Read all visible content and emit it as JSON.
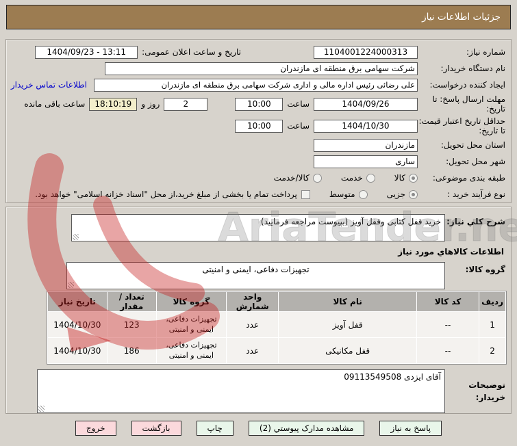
{
  "title": "جزئیات اطلاعات نیاز",
  "form": {
    "need_number": {
      "label": "شماره نیاز:",
      "value": "1104001224000313"
    },
    "announce": {
      "label": "تاریخ و ساعت اعلان عمومی:",
      "value": "1404/09/23 - 13:11"
    },
    "buyer_org": {
      "label": "نام دستگاه خریدار:",
      "value": "شرکت سهامی برق منطقه ای مازندران"
    },
    "creator": {
      "label": "ایجاد کننده درخواست:",
      "value": "علی رضائی رئیس اداره مالی و اداری شرکت سهامی برق منطقه ای مازندران",
      "contact_link": "اطلاعات تماس خریدار"
    },
    "deadline": {
      "label": "مهلت ارسال پاسخ: تا تاریخ:",
      "date": "1404/09/26",
      "time_label": "ساعت",
      "time": "10:00"
    },
    "countdown": {
      "days": "2",
      "days_suffix": "روز و",
      "time": "18:10:19",
      "time_suffix": "ساعت باقی مانده"
    },
    "validity": {
      "label": "حداقل تاریخ اعتبار قیمت: تا تاریخ:",
      "date": "1404/10/30",
      "time_label": "ساعت",
      "time": "10:00"
    },
    "province": {
      "label": "استان محل تحویل:",
      "value": "مازندران"
    },
    "city": {
      "label": "شهر محل تحویل:",
      "value": "ساری"
    },
    "classification": {
      "label": "طبقه بندی موضوعی:",
      "options": [
        "کالا",
        "خدمت",
        "کالا/خدمت"
      ],
      "selected": "کالا"
    },
    "process": {
      "label": "نوع فرآیند خرید :",
      "options": [
        "جزیی",
        "متوسط"
      ],
      "selected": "جزیی",
      "payment_note": "پرداخت تمام یا بخشی از مبلغ خرید،از محل \"اسناد خزانه اسلامی\" خواهد بود."
    }
  },
  "description": {
    "label": "شرح کلي نیاز:",
    "value": "خرید قفل کتابی وقفل آویز (بپیوست مراجعه فرمایید)"
  },
  "goods": {
    "section_header": "اطلاعات کالاهاي مورد نیاز",
    "group_label": "گروه کالا:",
    "group_value": "تجهیزات دفاعی، ایمنی و امنیتی"
  },
  "table": {
    "headers": [
      "ردیف",
      "کد کالا",
      "نام کالا",
      "واحد شمارش",
      "گروه کالا",
      "تعداد / مقدار",
      "تاریخ نیاز"
    ],
    "rows": [
      [
        "1",
        "--",
        "قفل آویز",
        "عدد",
        "تجهیزات دفاعی، ایمنی و امنیتی",
        "123",
        "1404/10/30"
      ],
      [
        "2",
        "--",
        "قفل مکانیکی",
        "عدد",
        "تجهیزات دفاعی، ایمنی و امنیتی",
        "186",
        "1404/10/30"
      ]
    ]
  },
  "notes": {
    "label": "توضیحات خریدار:",
    "value": "آقای ایزدی 09113549508"
  },
  "buttons": {
    "respond": "پاسخ به نیاز",
    "view_docs": "مشاهده مدارک پیوستي (2)",
    "print": "چاپ",
    "back": "بازگشت",
    "exit": "خروج"
  },
  "watermark": {
    "text": "AriaTender.neT"
  },
  "colors": {
    "header_bg": "#9c7c51",
    "link": "#0000cc",
    "highlight_bg": "#f3eecb",
    "button_green": "#e9f6ea",
    "button_pink": "#fbd9dc"
  }
}
